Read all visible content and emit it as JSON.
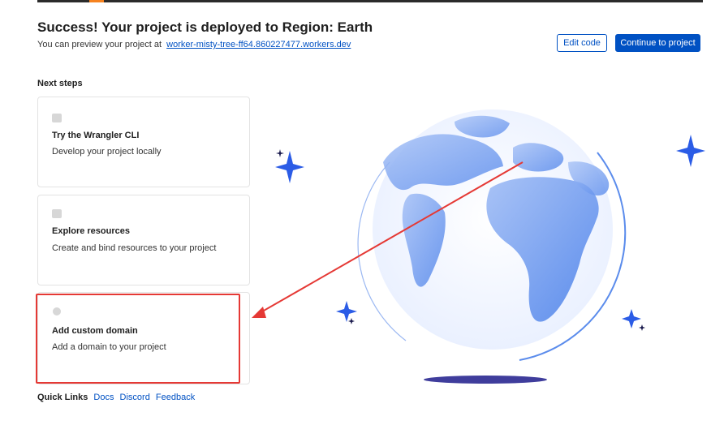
{
  "header": {
    "title": "Success! Your project is deployed to Region: Earth",
    "preview_text": "You can preview your project at",
    "preview_link": "worker-misty-tree-ff64.860227477.workers.dev",
    "edit_label": "Edit code",
    "continue_label": "Continue to project"
  },
  "next_steps": {
    "heading": "Next steps",
    "cards": [
      {
        "title": "Try the Wrangler CLI",
        "description": "Develop your project locally",
        "icon": "terminal-icon"
      },
      {
        "title": "Explore resources",
        "description": "Create and bind resources to your project",
        "icon": "link-icon"
      },
      {
        "title": "Add custom domain",
        "description": "Add a domain to your project",
        "icon": "globe-icon"
      }
    ]
  },
  "quick_links": {
    "label": "Quick Links",
    "links": [
      "Docs",
      "Discord",
      "Feedback"
    ]
  },
  "colors": {
    "accent": "#0051c3",
    "annotation": "#e53935",
    "globe": "#6f9cf0"
  }
}
